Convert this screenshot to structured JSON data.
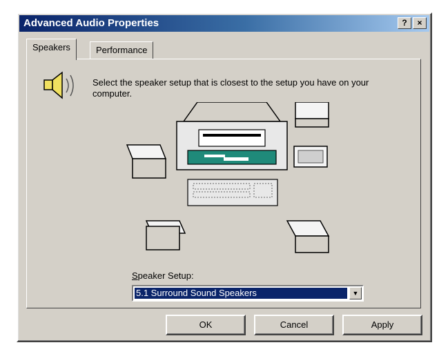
{
  "window": {
    "title": "Advanced Audio Properties",
    "help_button": "?",
    "close_button": "×"
  },
  "tabs": [
    {
      "label": "Speakers",
      "active": true
    },
    {
      "label": "Performance",
      "active": false
    }
  ],
  "speakers": {
    "description": "Select the speaker setup that is closest to the setup you have on your computer.",
    "setup_label_prefix": "S",
    "setup_label_rest": "peaker Setup:",
    "setup_value": "5.1 Surround Sound Speakers"
  },
  "buttons": {
    "ok": "OK",
    "cancel": "Cancel",
    "apply": "Apply"
  },
  "colors": {
    "title_bar": "#0a246a",
    "dialog_bg": "#d4d0c8",
    "selection": "#0a246a",
    "pc_screen": "#1f8a7a"
  }
}
